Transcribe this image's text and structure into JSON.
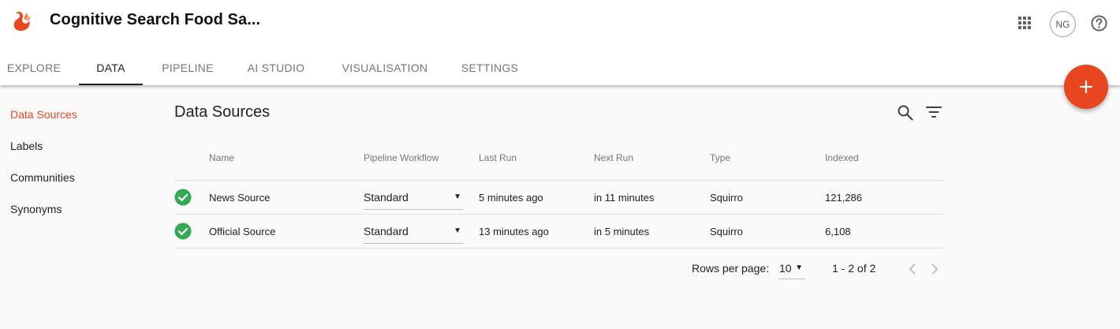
{
  "app": {
    "title": "Cognitive Search Food Sa...",
    "logo_icon": "squirrel-logo",
    "user_initials": "NG",
    "accent_color": "#e8461f"
  },
  "tabs": [
    {
      "label": "EXPLORE",
      "active": false
    },
    {
      "label": "DATA",
      "active": true
    },
    {
      "label": "PIPELINE",
      "active": false
    },
    {
      "label": "AI STUDIO",
      "active": false
    },
    {
      "label": "VISUALISATION",
      "active": false
    },
    {
      "label": "SETTINGS",
      "active": false
    }
  ],
  "sidebar": {
    "items": [
      {
        "label": "Data Sources",
        "active": true
      },
      {
        "label": "Labels",
        "active": false
      },
      {
        "label": "Communities",
        "active": false
      },
      {
        "label": "Synonyms",
        "active": false
      }
    ]
  },
  "main": {
    "title": "Data Sources",
    "columns": [
      "Name",
      "Pipeline Workflow",
      "Last Run",
      "Next Run",
      "Type",
      "Indexed"
    ],
    "rows": [
      {
        "status": "success",
        "name": "News Source",
        "workflow": "Standard",
        "last_run": "5 minutes ago",
        "next_run": "in 11 minutes",
        "type": "Squirro",
        "indexed": "121,286"
      },
      {
        "status": "success",
        "name": "Official Source",
        "workflow": "Standard",
        "last_run": "13 minutes ago",
        "next_run": "in 5 minutes",
        "type": "Squirro",
        "indexed": "6,108"
      }
    ]
  },
  "pagination": {
    "rows_per_page_label": "Rows per page:",
    "rows_per_page": "10",
    "range": "1 - 2 of 2"
  },
  "status_color": "#34a853"
}
